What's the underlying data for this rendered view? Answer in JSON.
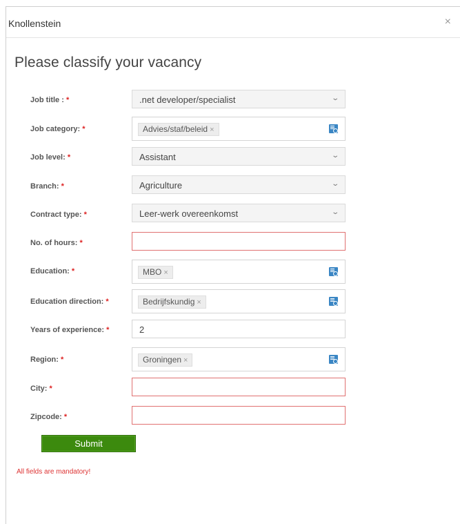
{
  "dialog": {
    "title": "Knollenstein",
    "close": "×",
    "heading": "Please classify your vacancy"
  },
  "required_mark": "*",
  "fields": {
    "job_title": {
      "label": "Job title :",
      "value": ".net developer/specialist"
    },
    "job_category": {
      "label": "Job category:",
      "tag": "Advies/staf/beleid"
    },
    "job_level": {
      "label": "Job level:",
      "value": "Assistant"
    },
    "branch": {
      "label": "Branch:",
      "value": "Agriculture"
    },
    "contract_type": {
      "label": "Contract type:",
      "value": "Leer-werk overeenkomst"
    },
    "hours": {
      "label": "No. of hours:",
      "value": ""
    },
    "education": {
      "label": "Education:",
      "tag": "MBO"
    },
    "education_direction": {
      "label": "Education direction:",
      "tag": "Bedrijfskundig"
    },
    "experience": {
      "label": "Years of experience:",
      "value": "2"
    },
    "region": {
      "label": "Region:",
      "tag": "Groningen"
    },
    "city": {
      "label": "City:",
      "value": ""
    },
    "zipcode": {
      "label": "Zipcode:",
      "value": ""
    }
  },
  "tag_remove": "×",
  "submit_label": "Submit",
  "mandatory_note": "All fields are mandatory!"
}
